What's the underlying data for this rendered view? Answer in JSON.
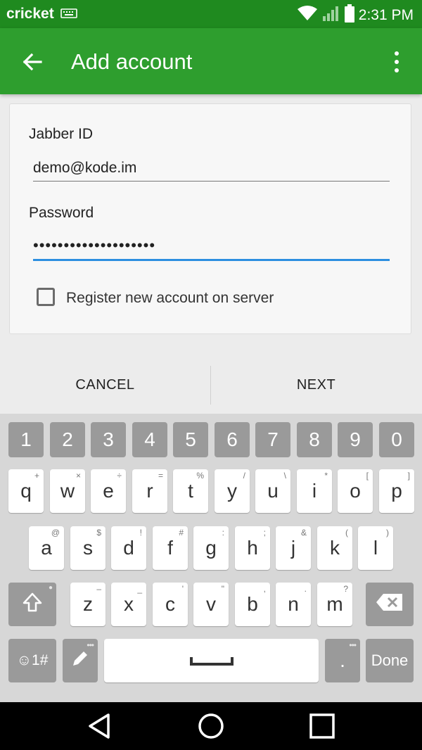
{
  "status_bar": {
    "carrier": "cricket",
    "time": "2:31 PM",
    "icons": [
      "keyboard-icon",
      "wifi-icon",
      "signal-icon",
      "battery-icon"
    ]
  },
  "app_bar": {
    "title": "Add account",
    "back_icon": "back-arrow-icon",
    "menu_icon": "overflow-menu-icon"
  },
  "form": {
    "jabber_label": "Jabber ID",
    "jabber_value": "demo@kode.im",
    "password_label": "Password",
    "password_value": "••••••••••••••••••••",
    "register_label": "Register new account on server",
    "register_checked": false
  },
  "actions": {
    "cancel_label": "CANCEL",
    "next_label": "NEXT"
  },
  "keyboard": {
    "numbers": [
      "1",
      "2",
      "3",
      "4",
      "5",
      "6",
      "7",
      "8",
      "9",
      "0"
    ],
    "row1": [
      {
        "k": "q",
        "alt": "+"
      },
      {
        "k": "w",
        "alt": "×"
      },
      {
        "k": "e",
        "alt": "÷"
      },
      {
        "k": "r",
        "alt": "="
      },
      {
        "k": "t",
        "alt": "%"
      },
      {
        "k": "y",
        "alt": "/"
      },
      {
        "k": "u",
        "alt": "\\"
      },
      {
        "k": "i",
        "alt": "*"
      },
      {
        "k": "o",
        "alt": "["
      },
      {
        "k": "p",
        "alt": "]"
      }
    ],
    "row2": [
      {
        "k": "a",
        "alt": "@"
      },
      {
        "k": "s",
        "alt": "$"
      },
      {
        "k": "d",
        "alt": "!"
      },
      {
        "k": "f",
        "alt": "#"
      },
      {
        "k": "g",
        "alt": ":"
      },
      {
        "k": "h",
        "alt": ";"
      },
      {
        "k": "j",
        "alt": "&"
      },
      {
        "k": "k",
        "alt": "("
      },
      {
        "k": "l",
        "alt": ")"
      }
    ],
    "row3": [
      {
        "k": "z",
        "alt": "–"
      },
      {
        "k": "x",
        "alt": "_"
      },
      {
        "k": "c",
        "alt": "'"
      },
      {
        "k": "v",
        "alt": "\""
      },
      {
        "k": "b",
        "alt": ","
      },
      {
        "k": "n",
        "alt": "."
      },
      {
        "k": "m",
        "alt": "?"
      }
    ],
    "emoji_label": "☺1#",
    "period_label": ".",
    "done_label": "Done"
  },
  "colors": {
    "status_bar": "#1f8a1f",
    "app_bar": "#2e9e2e",
    "focus_accent": "#2d8fe0"
  }
}
